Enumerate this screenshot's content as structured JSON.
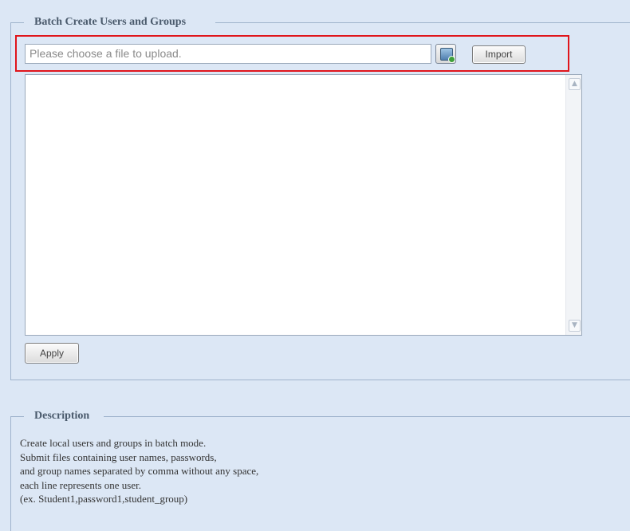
{
  "batch_section": {
    "legend": "Batch Create Users and Groups",
    "file_input_placeholder": "Please choose a file to upload.",
    "browse_icon": "file-browse-icon",
    "import_label": "Import",
    "textarea_value": "",
    "apply_label": "Apply"
  },
  "description_section": {
    "legend": "Description",
    "lines": [
      "Create local users and groups in batch mode.",
      "Submit files containing user names, passwords,",
      "and group names separated by comma without any space,",
      "each line represents one user.",
      "(ex. Student1,password1,student_group)"
    ]
  },
  "colors": {
    "page_background": "#dce7f5",
    "fieldset_border": "#9fb3cc",
    "highlight_border": "#e0151b",
    "legend_text": "#4a5a6c"
  }
}
